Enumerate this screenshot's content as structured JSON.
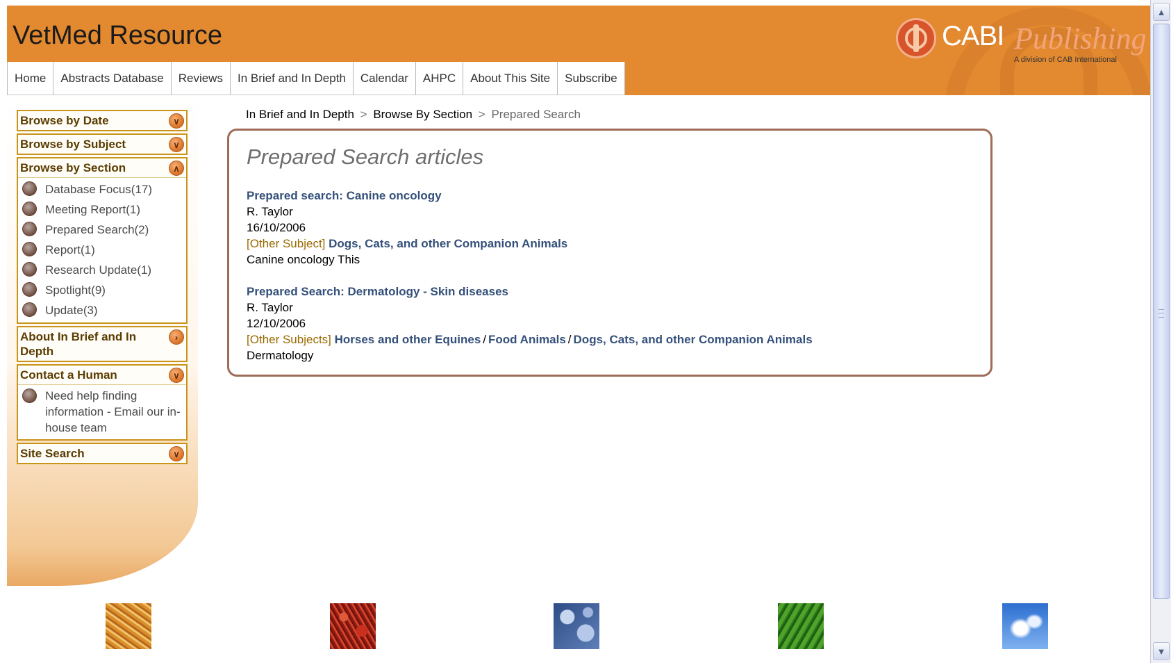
{
  "header": {
    "site_title": "VetMed Resource",
    "logo": {
      "word": "CABI",
      "sub": "Publishing",
      "tagline": "A division of CAB International"
    }
  },
  "nav": {
    "items": [
      "Home",
      "Abstracts Database",
      "Reviews",
      "In Brief and In Depth",
      "Calendar",
      "AHPC",
      "About This Site",
      "Subscribe"
    ]
  },
  "sidebar": {
    "browse_date": "Browse by Date",
    "browse_subject": "Browse by Subject",
    "browse_section": "Browse by Section",
    "sections": [
      "Database Focus(17)",
      "Meeting Report(1)",
      "Prepared Search(2)",
      "Report(1)",
      "Research Update(1)",
      "Spotlight(9)",
      "Update(3)"
    ],
    "about": "About In Brief and In Depth",
    "contact": "Contact a Human",
    "contact_text": "Need help finding information - Email our in-house team",
    "site_search": "Site Search"
  },
  "breadcrumb": {
    "items": [
      "In Brief and In Depth",
      "Browse By Section",
      "Prepared Search"
    ],
    "separator": ">"
  },
  "content": {
    "title": "Prepared Search articles",
    "articles": [
      {
        "title": "Prepared search: Canine oncology",
        "author": "R. Taylor",
        "date": "16/10/2006",
        "subject_label": "[Other Subject]",
        "subjects": [
          "Dogs, Cats, and other Companion Animals"
        ],
        "summary": "Canine oncology This"
      },
      {
        "title": "Prepared Search: Dermatology - Skin diseases",
        "author": "R. Taylor",
        "date": "12/10/2006",
        "subject_label": "[Other Subjects]",
        "subjects": [
          "Horses and other Equines",
          "Food Animals",
          "Dogs, Cats, and other Companion Animals"
        ],
        "subject_separator": "/",
        "summary": "Dermatology"
      }
    ]
  },
  "colors": {
    "header_orange": "#e3892f",
    "panel_border": "#c9941a",
    "link_blue": "#34507a",
    "subject_label": "#9a6a00",
    "content_border": "#9e6c58"
  }
}
